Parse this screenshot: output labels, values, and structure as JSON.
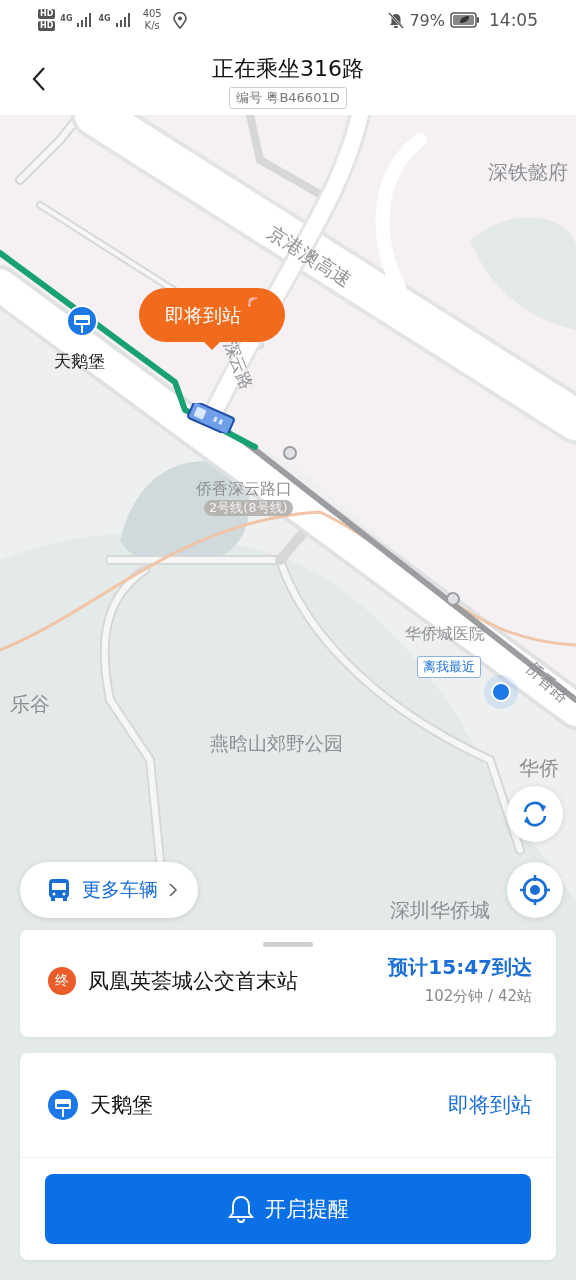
{
  "status_bar": {
    "sim_labels": [
      "HD",
      "HD"
    ],
    "network_labels": [
      "4G",
      "4G"
    ],
    "network_speed": "405",
    "speed_unit": "K/s",
    "battery": "79%",
    "time": "14:05"
  },
  "header": {
    "title": "正在乘坐316路",
    "plate": "编号 粤B46601D"
  },
  "map": {
    "labels": [
      {
        "text": "深铁懿府",
        "kind": "place"
      },
      {
        "text": "京港澳高速",
        "kind": "road"
      },
      {
        "text": "深云路",
        "kind": "road"
      },
      {
        "text": "天鹅堡",
        "kind": "stop"
      },
      {
        "text": "侨香深云路口",
        "kind": "place"
      },
      {
        "text": "2号线(8号线)",
        "kind": "metro"
      },
      {
        "text": "华侨城医院",
        "kind": "place"
      },
      {
        "text": "侨香路",
        "kind": "road"
      },
      {
        "text": "乐谷",
        "kind": "place"
      },
      {
        "text": "燕晗山郊野公园",
        "kind": "place"
      },
      {
        "text": "华侨",
        "kind": "place"
      },
      {
        "text": "深圳华侨城",
        "kind": "place"
      }
    ],
    "bus_bubble": "即将到站",
    "nearest_tag": "离我最近"
  },
  "more_vehicles": "更多车辆",
  "destination": {
    "badge": "终",
    "name": "凤凰英荟城公交首末站",
    "eta": "预计15:47到达",
    "detail": "102分钟 / 42站"
  },
  "current_stop": {
    "name": "天鹅堡",
    "status": "即将到站"
  },
  "reminder_button": "开启提醒"
}
